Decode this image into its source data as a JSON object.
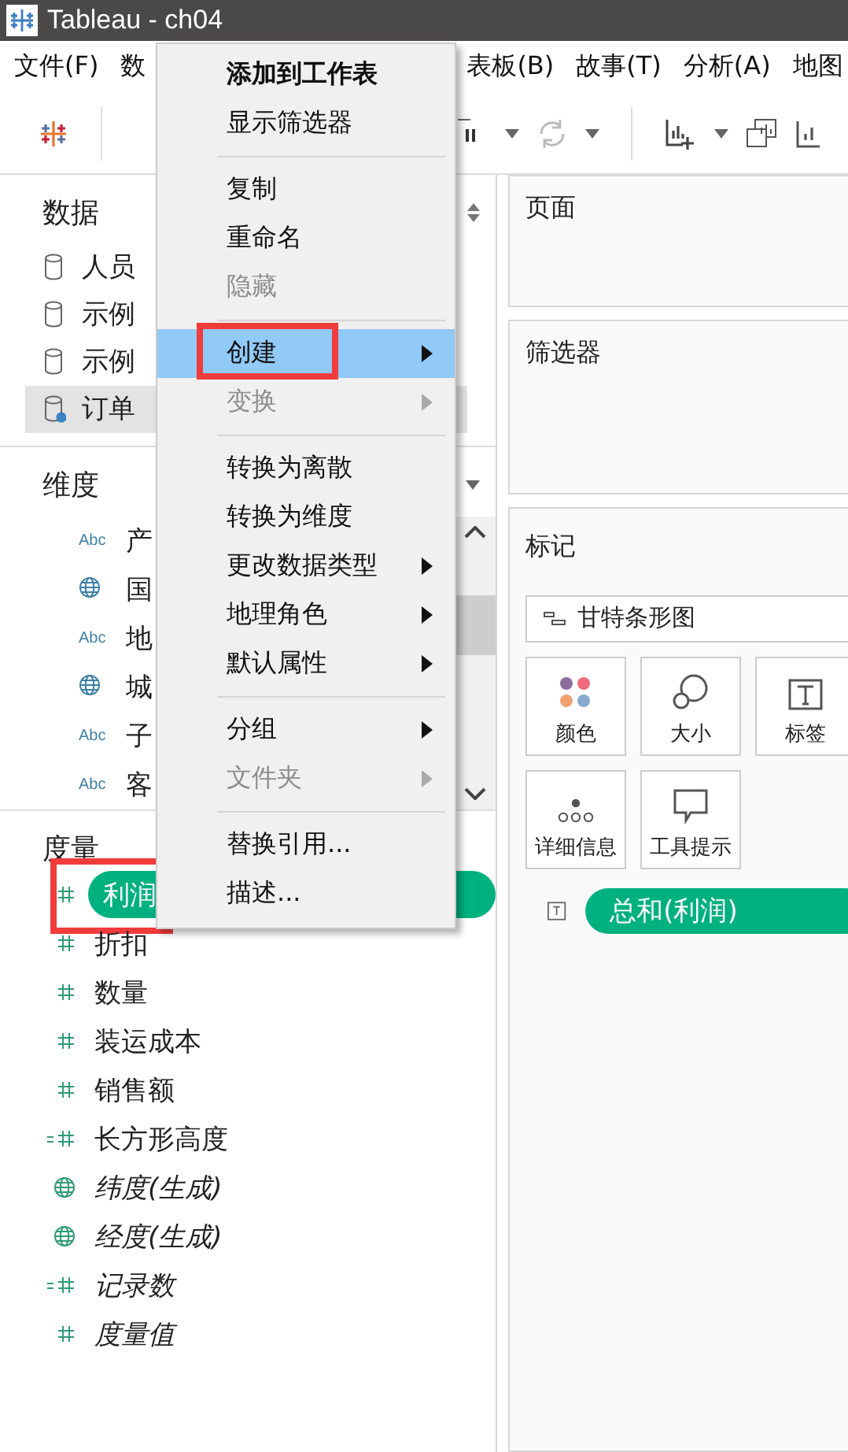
{
  "window": {
    "title": "Tableau - ch04"
  },
  "menubar": [
    {
      "label": "文件(F)"
    },
    {
      "label": "数"
    },
    {
      "label": "表板(B)",
      "gap": true
    },
    {
      "label": "故事(T)"
    },
    {
      "label": "分析(A)"
    },
    {
      "label": "地图"
    }
  ],
  "data_pane": {
    "title": "数据",
    "sources": [
      {
        "label": "人员",
        "selected": false
      },
      {
        "label": "示例",
        "selected": false
      },
      {
        "label": "示例",
        "selected": false
      },
      {
        "label": "订单",
        "selected": true
      }
    ]
  },
  "dimensions": {
    "title": "维度",
    "items": [
      {
        "kind": "abc",
        "type_text": "Abc",
        "label": "产"
      },
      {
        "kind": "globe",
        "label": "国"
      },
      {
        "kind": "abc",
        "type_text": "Abc",
        "label": "地"
      },
      {
        "kind": "globe",
        "label": "城"
      },
      {
        "kind": "abc",
        "type_text": "Abc",
        "label": "子"
      },
      {
        "kind": "abc",
        "type_text": "Abc",
        "label": "客"
      }
    ]
  },
  "measures": {
    "title": "度量",
    "items": [
      {
        "kind": "number",
        "label": "利润",
        "selected": true,
        "italic": false,
        "annotated": true
      },
      {
        "kind": "number",
        "label": "折扣",
        "selected": false,
        "italic": false,
        "annotated": false
      },
      {
        "kind": "number",
        "label": "数量",
        "selected": false,
        "italic": false,
        "annotated": false
      },
      {
        "kind": "number",
        "label": "装运成本",
        "selected": false,
        "italic": false,
        "annotated": false
      },
      {
        "kind": "number",
        "label": "销售额",
        "selected": false,
        "italic": false,
        "annotated": false
      },
      {
        "kind": "calc",
        "label": "长方形高度",
        "selected": false,
        "italic": false,
        "annotated": false
      },
      {
        "kind": "globe",
        "label": "纬度(生成)",
        "selected": false,
        "italic": true,
        "annotated": false
      },
      {
        "kind": "globe",
        "label": "经度(生成)",
        "selected": false,
        "italic": true,
        "annotated": false
      },
      {
        "kind": "calc",
        "label": "记录数",
        "selected": false,
        "italic": true,
        "annotated": false
      },
      {
        "kind": "number",
        "label": "度量值",
        "selected": false,
        "italic": true,
        "annotated": false
      }
    ]
  },
  "context_menu": [
    {
      "kind": "item",
      "label": "添加到工作表",
      "bold": true,
      "disabled": false,
      "submenu": false,
      "selected": false,
      "annotated": false
    },
    {
      "kind": "item",
      "label": "显示筛选器",
      "bold": false,
      "disabled": false,
      "submenu": false,
      "selected": false,
      "annotated": false
    },
    {
      "kind": "separator"
    },
    {
      "kind": "item",
      "label": "复制",
      "bold": false,
      "disabled": false,
      "submenu": false,
      "selected": false,
      "annotated": false
    },
    {
      "kind": "item",
      "label": "重命名",
      "bold": false,
      "disabled": false,
      "submenu": false,
      "selected": false,
      "annotated": false
    },
    {
      "kind": "item",
      "label": "隐藏",
      "bold": false,
      "disabled": true,
      "submenu": false,
      "selected": false,
      "annotated": false
    },
    {
      "kind": "separator"
    },
    {
      "kind": "item",
      "label": "创建",
      "bold": false,
      "disabled": false,
      "submenu": true,
      "selected": true,
      "annotated": true
    },
    {
      "kind": "item",
      "label": "变换",
      "bold": false,
      "disabled": true,
      "submenu": true,
      "selected": false,
      "annotated": false
    },
    {
      "kind": "separator"
    },
    {
      "kind": "item",
      "label": "转换为离散",
      "bold": false,
      "disabled": false,
      "submenu": false,
      "selected": false,
      "annotated": false
    },
    {
      "kind": "item",
      "label": "转换为维度",
      "bold": false,
      "disabled": false,
      "submenu": false,
      "selected": false,
      "annotated": false
    },
    {
      "kind": "item",
      "label": "更改数据类型",
      "bold": false,
      "disabled": false,
      "submenu": true,
      "selected": false,
      "annotated": false
    },
    {
      "kind": "item",
      "label": "地理角色",
      "bold": false,
      "disabled": false,
      "submenu": true,
      "selected": false,
      "annotated": false
    },
    {
      "kind": "item",
      "label": "默认属性",
      "bold": false,
      "disabled": false,
      "submenu": true,
      "selected": false,
      "annotated": false
    },
    {
      "kind": "separator"
    },
    {
      "kind": "item",
      "label": "分组",
      "bold": false,
      "disabled": false,
      "submenu": true,
      "selected": false,
      "annotated": false
    },
    {
      "kind": "item",
      "label": "文件夹",
      "bold": false,
      "disabled": true,
      "submenu": true,
      "selected": false,
      "annotated": false
    },
    {
      "kind": "separator"
    },
    {
      "kind": "item",
      "label": "替换引用...",
      "bold": false,
      "disabled": false,
      "submenu": false,
      "selected": false,
      "annotated": false
    },
    {
      "kind": "item",
      "label": "描述...",
      "bold": false,
      "disabled": false,
      "submenu": false,
      "selected": false,
      "annotated": false
    }
  ],
  "pages_card": {
    "title": "页面"
  },
  "filters_card": {
    "title": "筛选器"
  },
  "marks_card": {
    "title": "标记",
    "mark_type": "甘特条形图",
    "buttons": [
      {
        "kind": "color",
        "label": "颜色"
      },
      {
        "kind": "size",
        "label": "大小"
      },
      {
        "kind": "label",
        "label": "标签"
      },
      {
        "kind": "detail",
        "label": "详细信息"
      },
      {
        "kind": "tooltip",
        "label": "工具提示"
      }
    ],
    "fields": [
      {
        "kind": "label",
        "label": "总和(利润)"
      }
    ]
  }
}
